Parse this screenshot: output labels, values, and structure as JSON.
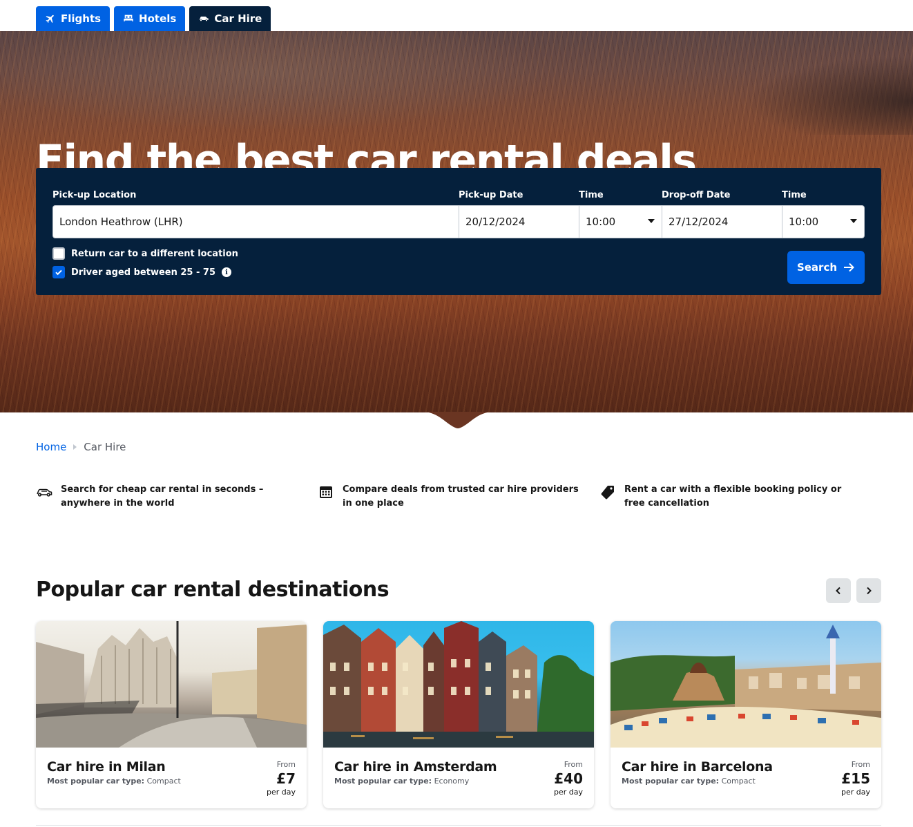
{
  "tabs": [
    {
      "label": "Flights",
      "icon": "plane-icon",
      "active": false
    },
    {
      "label": "Hotels",
      "icon": "bed-icon",
      "active": false
    },
    {
      "label": "Car Hire",
      "icon": "car-icon",
      "active": true
    }
  ],
  "hero": {
    "title": "Find the best car rental deals"
  },
  "search": {
    "pickup_location_label": "Pick-up Location",
    "pickup_location_value": "London Heathrow (LHR)",
    "pickup_date_label": "Pick-up Date",
    "pickup_date_value": "20/12/2024",
    "pickup_time_label": "Time",
    "pickup_time_value": "10:00",
    "dropoff_date_label": "Drop-off Date",
    "dropoff_date_value": "27/12/2024",
    "dropoff_time_label": "Time",
    "dropoff_time_value": "10:00",
    "return_different_label": "Return car to a different location",
    "return_different_checked": false,
    "driver_age_label": "Driver aged between 25 - 75",
    "driver_age_checked": true,
    "search_button": "Search"
  },
  "breadcrumb": {
    "home": "Home",
    "current": "Car Hire"
  },
  "features": [
    {
      "icon": "car-icon",
      "text": "Search for cheap car rental in seconds – anywhere in the world"
    },
    {
      "icon": "calendar-icon",
      "text": "Compare deals from trusted car hire providers in one place"
    },
    {
      "icon": "tag-icon",
      "text": "Rent a car with a flexible booking policy or free cancellation"
    }
  ],
  "popular": {
    "title": "Popular car rental destinations",
    "cards": [
      {
        "title": "Car hire in Milan",
        "type_label": "Most popular car type:",
        "type_value": "Compact",
        "from": "From",
        "price": "£7",
        "per": "per day"
      },
      {
        "title": "Car hire in Amsterdam",
        "type_label": "Most popular car type:",
        "type_value": "Economy",
        "from": "From",
        "price": "£40",
        "per": "per day"
      },
      {
        "title": "Car hire in Barcelona",
        "type_label": "Most popular car type:",
        "type_value": "Compact",
        "from": "From",
        "price": "£15",
        "per": "per day"
      }
    ]
  },
  "colors": {
    "brand_blue": "#0062e3",
    "navy": "#05203c"
  }
}
